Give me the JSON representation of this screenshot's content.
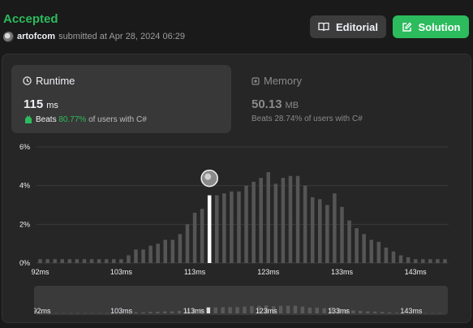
{
  "header": {
    "status": "Accepted",
    "username": "artofcom",
    "submitted_text": "submitted at Apr 28, 2024 06:29",
    "editorial_label": "Editorial",
    "solution_label": "Solution"
  },
  "runtime": {
    "title": "Runtime",
    "value": "115",
    "unit": "ms",
    "beats_label": "Beats",
    "beats_pct": "80.77%",
    "beats_suffix": "of users with C#"
  },
  "memory": {
    "title": "Memory",
    "value": "50.13",
    "unit": "MB",
    "beats_label": "Beats",
    "beats_pct": "28.74%",
    "beats_suffix": "of users with C#"
  },
  "colors": {
    "accent_green": "#2cbb5d",
    "bar": "#555555",
    "highlight_bar": "#ffffff"
  },
  "chart_data": {
    "type": "bar",
    "ylabel_ticks": [
      "6%",
      "4%",
      "2%",
      "0%"
    ],
    "ylim": [
      0,
      6
    ],
    "x_tick_labels": [
      "92ms",
      "103ms",
      "113ms",
      "123ms",
      "133ms",
      "143ms"
    ],
    "x_start_ms": 92,
    "x_step_ms": 1,
    "values": [
      0.2,
      0.2,
      0.2,
      0.2,
      0.2,
      0.2,
      0.2,
      0.2,
      0.2,
      0.2,
      0.2,
      0.2,
      0.4,
      0.7,
      0.7,
      0.9,
      1.0,
      1.2,
      1.2,
      1.5,
      2.0,
      2.6,
      2.8,
      2.7,
      3.5,
      3.6,
      3.7,
      3.7,
      4.0,
      4.2,
      4.4,
      4.7,
      4.1,
      4.4,
      4.5,
      4.5,
      4.0,
      3.4,
      3.3,
      3.0,
      3.6,
      2.9,
      2.2,
      1.8,
      1.5,
      1.2,
      1.1,
      0.8,
      0.6,
      0.4,
      0.3,
      0.2,
      0.2,
      0.2,
      0.2,
      0.2
    ],
    "highlight_ms": 115,
    "highlight_value": 3.5
  }
}
